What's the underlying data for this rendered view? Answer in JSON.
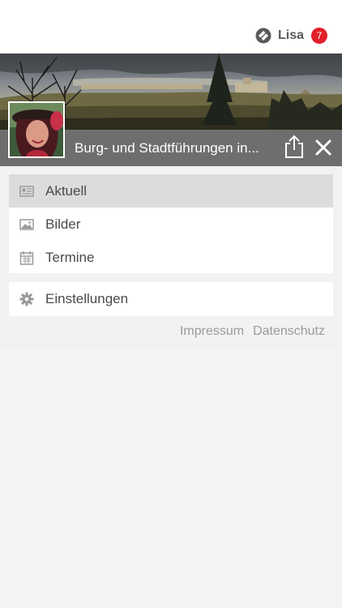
{
  "header": {
    "user_name": "Lisa",
    "notification_count": "7",
    "brand_icon": "app-logo-icon"
  },
  "hero": {
    "image": "castle-landscape-panorama",
    "avatar": "profile-photo-woman-red-hat"
  },
  "title_bar": {
    "title": "Burg- und Stadtführungen in...",
    "share_icon": "share-icon",
    "close_icon": "close-icon"
  },
  "menu": {
    "items": [
      {
        "label": "Aktuell",
        "icon": "newspaper-icon",
        "active": true
      },
      {
        "label": "Bilder",
        "icon": "image-icon",
        "active": false
      },
      {
        "label": "Termine",
        "icon": "calendar-icon",
        "active": false
      }
    ]
  },
  "settings": {
    "label": "Einstellungen",
    "icon": "gear-icon"
  },
  "footer": {
    "impressum": "Impressum",
    "datenschutz": "Datenschutz"
  },
  "colors": {
    "badge": "#e1202a",
    "title_bar": "#6e6e6e",
    "active_item": "#dcdcdc",
    "background": "#f2f2f2"
  }
}
